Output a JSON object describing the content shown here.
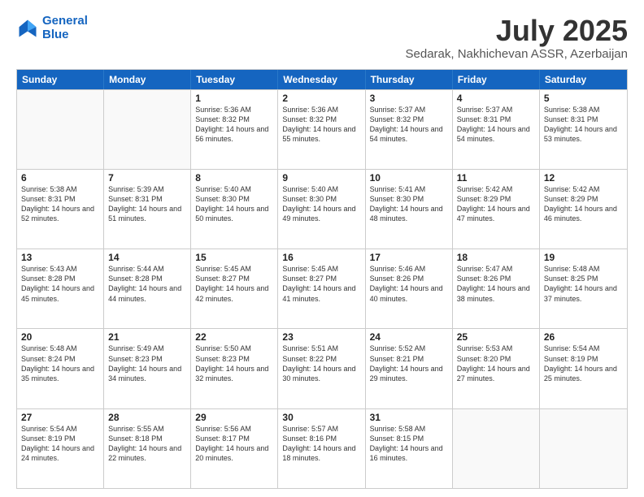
{
  "logo": {
    "line1": "General",
    "line2": "Blue"
  },
  "title": "July 2025",
  "subtitle": "Sedarak, Nakhichevan ASSR, Azerbaijan",
  "days_of_week": [
    "Sunday",
    "Monday",
    "Tuesday",
    "Wednesday",
    "Thursday",
    "Friday",
    "Saturday"
  ],
  "weeks": [
    [
      {
        "day": "",
        "empty": true
      },
      {
        "day": "",
        "empty": true
      },
      {
        "day": "1",
        "sunrise": "Sunrise: 5:36 AM",
        "sunset": "Sunset: 8:32 PM",
        "daylight": "Daylight: 14 hours and 56 minutes."
      },
      {
        "day": "2",
        "sunrise": "Sunrise: 5:36 AM",
        "sunset": "Sunset: 8:32 PM",
        "daylight": "Daylight: 14 hours and 55 minutes."
      },
      {
        "day": "3",
        "sunrise": "Sunrise: 5:37 AM",
        "sunset": "Sunset: 8:32 PM",
        "daylight": "Daylight: 14 hours and 54 minutes."
      },
      {
        "day": "4",
        "sunrise": "Sunrise: 5:37 AM",
        "sunset": "Sunset: 8:31 PM",
        "daylight": "Daylight: 14 hours and 54 minutes."
      },
      {
        "day": "5",
        "sunrise": "Sunrise: 5:38 AM",
        "sunset": "Sunset: 8:31 PM",
        "daylight": "Daylight: 14 hours and 53 minutes."
      }
    ],
    [
      {
        "day": "6",
        "sunrise": "Sunrise: 5:38 AM",
        "sunset": "Sunset: 8:31 PM",
        "daylight": "Daylight: 14 hours and 52 minutes."
      },
      {
        "day": "7",
        "sunrise": "Sunrise: 5:39 AM",
        "sunset": "Sunset: 8:31 PM",
        "daylight": "Daylight: 14 hours and 51 minutes."
      },
      {
        "day": "8",
        "sunrise": "Sunrise: 5:40 AM",
        "sunset": "Sunset: 8:30 PM",
        "daylight": "Daylight: 14 hours and 50 minutes."
      },
      {
        "day": "9",
        "sunrise": "Sunrise: 5:40 AM",
        "sunset": "Sunset: 8:30 PM",
        "daylight": "Daylight: 14 hours and 49 minutes."
      },
      {
        "day": "10",
        "sunrise": "Sunrise: 5:41 AM",
        "sunset": "Sunset: 8:30 PM",
        "daylight": "Daylight: 14 hours and 48 minutes."
      },
      {
        "day": "11",
        "sunrise": "Sunrise: 5:42 AM",
        "sunset": "Sunset: 8:29 PM",
        "daylight": "Daylight: 14 hours and 47 minutes."
      },
      {
        "day": "12",
        "sunrise": "Sunrise: 5:42 AM",
        "sunset": "Sunset: 8:29 PM",
        "daylight": "Daylight: 14 hours and 46 minutes."
      }
    ],
    [
      {
        "day": "13",
        "sunrise": "Sunrise: 5:43 AM",
        "sunset": "Sunset: 8:28 PM",
        "daylight": "Daylight: 14 hours and 45 minutes."
      },
      {
        "day": "14",
        "sunrise": "Sunrise: 5:44 AM",
        "sunset": "Sunset: 8:28 PM",
        "daylight": "Daylight: 14 hours and 44 minutes."
      },
      {
        "day": "15",
        "sunrise": "Sunrise: 5:45 AM",
        "sunset": "Sunset: 8:27 PM",
        "daylight": "Daylight: 14 hours and 42 minutes."
      },
      {
        "day": "16",
        "sunrise": "Sunrise: 5:45 AM",
        "sunset": "Sunset: 8:27 PM",
        "daylight": "Daylight: 14 hours and 41 minutes."
      },
      {
        "day": "17",
        "sunrise": "Sunrise: 5:46 AM",
        "sunset": "Sunset: 8:26 PM",
        "daylight": "Daylight: 14 hours and 40 minutes."
      },
      {
        "day": "18",
        "sunrise": "Sunrise: 5:47 AM",
        "sunset": "Sunset: 8:26 PM",
        "daylight": "Daylight: 14 hours and 38 minutes."
      },
      {
        "day": "19",
        "sunrise": "Sunrise: 5:48 AM",
        "sunset": "Sunset: 8:25 PM",
        "daylight": "Daylight: 14 hours and 37 minutes."
      }
    ],
    [
      {
        "day": "20",
        "sunrise": "Sunrise: 5:48 AM",
        "sunset": "Sunset: 8:24 PM",
        "daylight": "Daylight: 14 hours and 35 minutes."
      },
      {
        "day": "21",
        "sunrise": "Sunrise: 5:49 AM",
        "sunset": "Sunset: 8:23 PM",
        "daylight": "Daylight: 14 hours and 34 minutes."
      },
      {
        "day": "22",
        "sunrise": "Sunrise: 5:50 AM",
        "sunset": "Sunset: 8:23 PM",
        "daylight": "Daylight: 14 hours and 32 minutes."
      },
      {
        "day": "23",
        "sunrise": "Sunrise: 5:51 AM",
        "sunset": "Sunset: 8:22 PM",
        "daylight": "Daylight: 14 hours and 30 minutes."
      },
      {
        "day": "24",
        "sunrise": "Sunrise: 5:52 AM",
        "sunset": "Sunset: 8:21 PM",
        "daylight": "Daylight: 14 hours and 29 minutes."
      },
      {
        "day": "25",
        "sunrise": "Sunrise: 5:53 AM",
        "sunset": "Sunset: 8:20 PM",
        "daylight": "Daylight: 14 hours and 27 minutes."
      },
      {
        "day": "26",
        "sunrise": "Sunrise: 5:54 AM",
        "sunset": "Sunset: 8:19 PM",
        "daylight": "Daylight: 14 hours and 25 minutes."
      }
    ],
    [
      {
        "day": "27",
        "sunrise": "Sunrise: 5:54 AM",
        "sunset": "Sunset: 8:19 PM",
        "daylight": "Daylight: 14 hours and 24 minutes."
      },
      {
        "day": "28",
        "sunrise": "Sunrise: 5:55 AM",
        "sunset": "Sunset: 8:18 PM",
        "daylight": "Daylight: 14 hours and 22 minutes."
      },
      {
        "day": "29",
        "sunrise": "Sunrise: 5:56 AM",
        "sunset": "Sunset: 8:17 PM",
        "daylight": "Daylight: 14 hours and 20 minutes."
      },
      {
        "day": "30",
        "sunrise": "Sunrise: 5:57 AM",
        "sunset": "Sunset: 8:16 PM",
        "daylight": "Daylight: 14 hours and 18 minutes."
      },
      {
        "day": "31",
        "sunrise": "Sunrise: 5:58 AM",
        "sunset": "Sunset: 8:15 PM",
        "daylight": "Daylight: 14 hours and 16 minutes."
      },
      {
        "day": "",
        "empty": true
      },
      {
        "day": "",
        "empty": true
      }
    ]
  ]
}
